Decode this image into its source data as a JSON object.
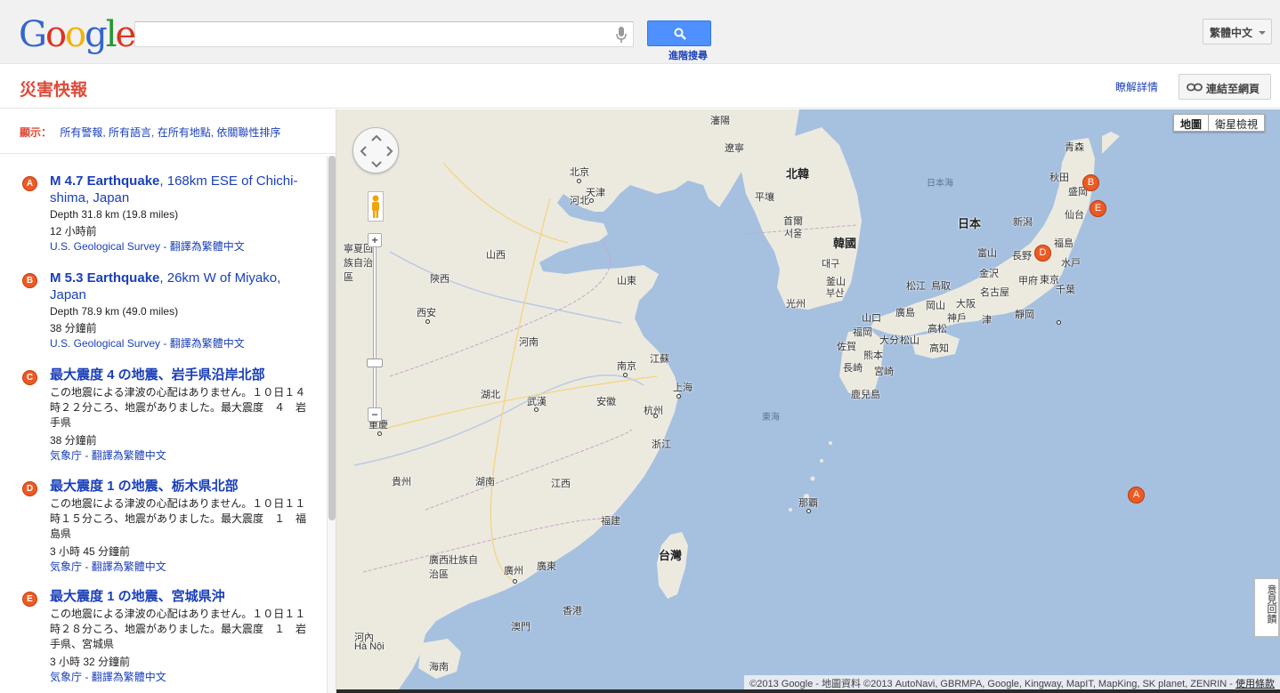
{
  "header": {
    "logo_letters": [
      "G",
      "o",
      "o",
      "g",
      "l",
      "e"
    ],
    "search_value": "",
    "search_placeholder": "",
    "advanced_search": "進階搜尋",
    "language": "繁體中文"
  },
  "subheader": {
    "title": "災害快報",
    "learn_more": "瞭解詳情",
    "link_button": "連結至網頁"
  },
  "filter": {
    "label": "顯示：",
    "text": "所有警報, 所有語言, 在所有地點, 依關聯性排序"
  },
  "alerts": [
    {
      "marker": "A",
      "title_bold": "M 4.7 Earthquake",
      "title_rest": ", 168km ESE of Chichi-shima, Japan",
      "detail": "Depth 31.8 km (19.8 miles)",
      "ago": "12 小時前",
      "source": "U.S. Geological Survey",
      "translate": "翻譯為繁體中文"
    },
    {
      "marker": "B",
      "title_bold": "M 5.3 Earthquake",
      "title_rest": ", 26km W of Miyako, Japan",
      "detail": "Depth 78.9 km (49.0 miles)",
      "ago": "38 分鐘前",
      "source": "U.S. Geological Survey",
      "translate": "翻譯為繁體中文"
    },
    {
      "marker": "C",
      "title_bold": "最大震度 4 の地震、岩手県沿岸北部",
      "title_rest": "",
      "detail": "この地震による津波の心配はありません。１０日１４時２２分ころ、地震がありました。最大震度　４　岩手県",
      "ago": "38 分鐘前",
      "source": "気象庁",
      "translate": "翻譯為繁體中文"
    },
    {
      "marker": "D",
      "title_bold": "最大震度 1 の地震、栃木県北部",
      "title_rest": "",
      "detail": "この地震による津波の心配はありません。１０日１１時１５分ころ、地震がありました。最大震度　１　福島県",
      "ago": "3 小時 45 分鐘前",
      "source": "気象庁",
      "translate": "翻譯為繁體中文"
    },
    {
      "marker": "E",
      "title_bold": "最大震度 1 の地震、宮城県沖",
      "title_rest": "",
      "detail": "この地震による津波の心配はありません。１０日１１時２８分ころ、地震がありました。最大震度　１　岩手県、宮城県",
      "ago": "3 小時 32 分鐘前",
      "source": "気象庁",
      "translate": "翻譯為繁體中文"
    }
  ],
  "map": {
    "map_type_map": "地圖",
    "map_type_satellite": "衛星檢視",
    "feedback": "意見回饋",
    "attribution": "©2013 Google - 地圖資料 ©2013 AutoNavi, GBRMPA, Google, Kingway, MapIT, MapKing, SK planet, ZENRIN -",
    "terms": "使用條款",
    "labels": {
      "countries": [
        "北韓",
        "韓國",
        "日本",
        "台灣"
      ],
      "seas": [
        "日本海",
        "東海"
      ],
      "places": [
        "瀋陽",
        "遼寧",
        "北京",
        "天津",
        "河北",
        "寧夏回族自治區",
        "山西",
        "山東",
        "陝西",
        "西安",
        "河南",
        "江蘇",
        "南京",
        "上海",
        "湖北",
        "武漢",
        "安徽",
        "杭州",
        "浙江",
        "重慶",
        "貴州",
        "湖南",
        "江西",
        "福建",
        "廣西壯族自治區",
        "廣州",
        "廣東",
        "香港",
        "澳門",
        "河內",
        "Hà Nội",
        "海南",
        "平壤",
        "首爾",
        "서울",
        "釜山",
        "부산",
        "光州",
        "대구",
        "青森",
        "秋田",
        "盛岡",
        "仙台",
        "新潟",
        "福島",
        "富山",
        "長野",
        "金沢",
        "水戸",
        "東京",
        "千葉",
        "甲府",
        "名古屋",
        "靜岡",
        "松江",
        "鳥取",
        "廣島",
        "岡山",
        "大阪",
        "神戶",
        "津",
        "山口",
        "福岡",
        "松山",
        "高松",
        "大分",
        "高知",
        "佐賀",
        "熊本",
        "長崎",
        "宮崎",
        "鹿兒島",
        "那覇"
      ]
    },
    "markers": [
      "A",
      "B",
      "D",
      "E"
    ],
    "colors": {
      "water": "#a6c0e0",
      "land": "#eceadf",
      "marker": "#ee5a24"
    },
    "icons": [
      "mic-icon",
      "search-icon",
      "link-icon",
      "pan-control-icon",
      "pegman-icon"
    ]
  }
}
